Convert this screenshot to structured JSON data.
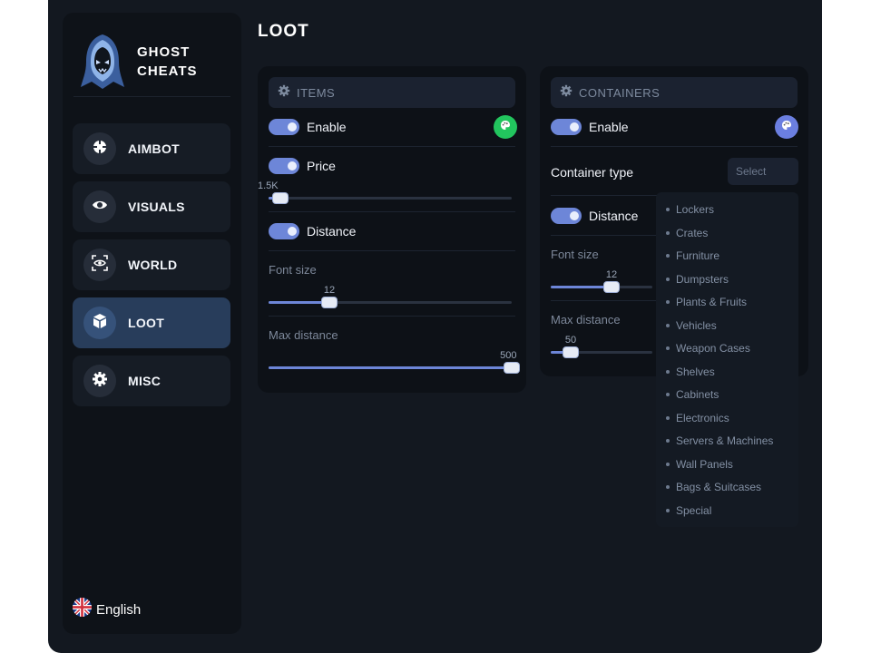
{
  "brand": {
    "line1": "GHOST",
    "line2": "CHEATS",
    "logo_icon": "ghost-hood-icon"
  },
  "nav": [
    {
      "label": "AIMBOT",
      "icon": "crosshair-icon",
      "active": false
    },
    {
      "label": "VISUALS",
      "icon": "eye-icon",
      "active": false
    },
    {
      "label": "WORLD",
      "icon": "world-eye-icon",
      "active": false
    },
    {
      "label": "LOOT",
      "icon": "box-icon",
      "active": true
    },
    {
      "label": "MISC",
      "icon": "gear-icon",
      "active": false
    }
  ],
  "language": {
    "label": "English",
    "icon": "uk-flag-icon"
  },
  "page_title": "LOOT",
  "items_panel": {
    "title": "ITEMS",
    "enable_label": "Enable",
    "enable_color": "#22c55e",
    "price_label": "Price",
    "price_value": "1.5K",
    "price_fraction": 0.05,
    "distance_label": "Distance",
    "font_size_label": "Font size",
    "font_size_value": "12",
    "font_size_fraction": 0.25,
    "max_distance_label": "Max distance",
    "max_distance_value": "500",
    "max_distance_fraction": 1.0
  },
  "containers_panel": {
    "title": "CONTAINERS",
    "enable_label": "Enable",
    "enable_color": "#6b7fe0",
    "container_type_label": "Container type",
    "select_placeholder": "Select",
    "distance_label": "Distance",
    "font_size_label": "Font size",
    "font_size_value": "12",
    "font_size_fraction": 0.6,
    "max_distance_label": "Max distance",
    "max_distance_value": "50",
    "max_distance_fraction": 0.2
  },
  "dropdown_options": [
    "Lockers",
    "Crates",
    "Furniture",
    "Dumpsters",
    "Plants & Fruits",
    "Vehicles",
    "Weapon Cases",
    "Shelves",
    "Cabinets",
    "Electronics",
    "Servers & Machines",
    "Wall Panels",
    "Bags & Suitcases",
    "Special"
  ],
  "colors": {
    "accent": "#6d86d8",
    "active_nav": "#283d5b",
    "background": "#131820"
  }
}
